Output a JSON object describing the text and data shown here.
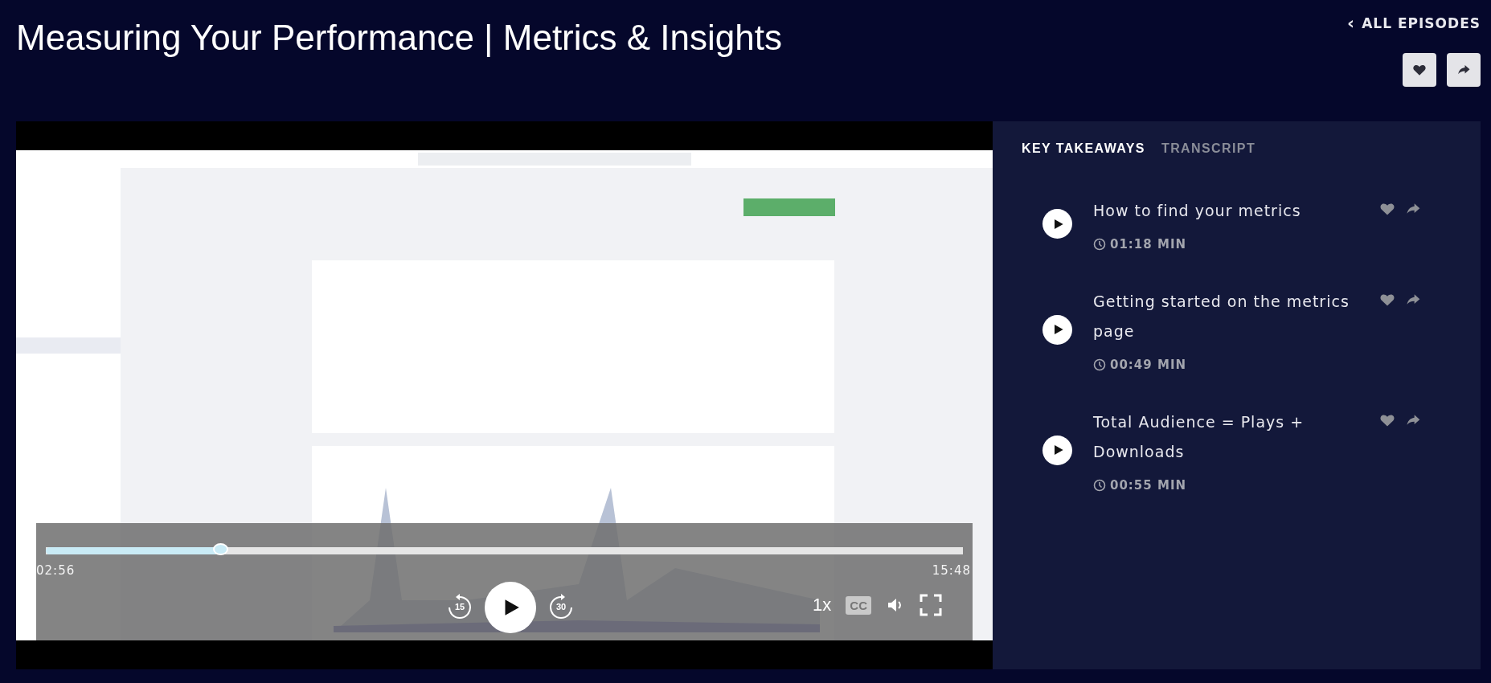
{
  "title": "Measuring Your Performance | Metrics & Insights",
  "back_link": {
    "icon": "‹",
    "label": "ALL EPISODES"
  },
  "video": {
    "kind": "picture",
    "controls": {
      "progress": {
        "level": 0.19
      },
      "elapsed": "02:56",
      "duration": "15:48",
      "skip_back": "15",
      "skip_forward": "30",
      "playing": false,
      "speed": "1x",
      "captions": "CC",
      "captions_on": false
    }
  },
  "tabs": [
    {
      "label": "KEY TAKEAWAYS",
      "selected": true
    },
    {
      "label": "TRANSCRIPT",
      "selected": false
    }
  ],
  "takeaways": [
    {
      "title": "How to find your metrics",
      "duration": "01:18 MIN"
    },
    {
      "title": "Getting started on the metrics page",
      "duration": "00:49 MIN"
    },
    {
      "title": "Total Audience = Plays + Downloads",
      "duration": "00:55 MIN"
    }
  ]
}
